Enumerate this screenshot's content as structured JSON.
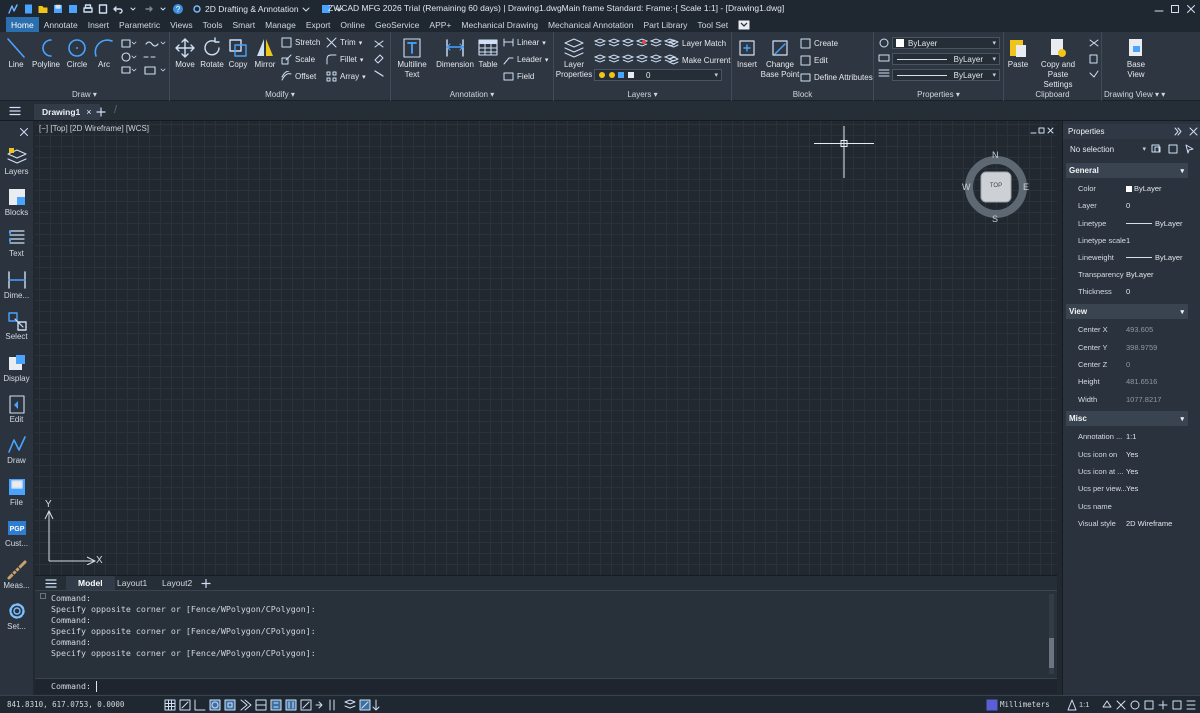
{
  "title_bar": {
    "workspace": "2D Drafting & Annotation",
    "title": "ZWCAD MFG 2026 Trial (Remaining 60 days) | Drawing1.dwgMain frame  Standard: Frame:-[ Scale 1:1] - [Drawing1.dwg]"
  },
  "ribbon_tabs": [
    "Home",
    "Annotate",
    "Insert",
    "Parametric",
    "Views",
    "Tools",
    "Smart",
    "Manage",
    "Export",
    "Online",
    "GeoService",
    "APP+",
    "Mechanical Drawing",
    "Mechanical Annotation",
    "Part Library",
    "Tool Set"
  ],
  "ribbon": {
    "draw": {
      "label": "Draw",
      "line": "Line",
      "polyline": "Polyline",
      "circle": "Circle",
      "arc": "Arc"
    },
    "modify": {
      "label": "Modify",
      "move": "Move",
      "rotate": "Rotate",
      "copy": "Copy",
      "mirror": "Mirror",
      "stretch": "Stretch",
      "scale": "Scale",
      "offset": "Offset",
      "trim": "Trim",
      "fillet": "Fillet",
      "array": "Array"
    },
    "annotation": {
      "label": "Annotation",
      "multiline_text_1": "Multiline",
      "multiline_text_2": "Text",
      "dimension": "Dimension",
      "table": "Table",
      "linear": "Linear",
      "leader": "Leader",
      "field": "Field"
    },
    "layers": {
      "label": "Layers",
      "layer_properties_1": "Layer",
      "layer_properties_2": "Properties",
      "layer_match": "Layer Match",
      "make_current": "Make Current",
      "current_layer": "0"
    },
    "block": {
      "label": "Block",
      "insert": "Insert",
      "change_base_1": "Change",
      "change_base_2": "Base Point",
      "create": "Create",
      "edit": "Edit",
      "define_attributes": "Define Attributes"
    },
    "properties": {
      "label": "Properties",
      "color": "ByLayer",
      "linetype": "ByLayer",
      "lineweight": "ByLayer"
    },
    "clipboard": {
      "label": "Clipboard",
      "paste": "Paste",
      "copy_paste_1": "Copy and Paste",
      "copy_paste_2": "Settings"
    },
    "drawing_view": {
      "label": "Drawing View",
      "base_view_1": "Base",
      "base_view_2": "View"
    }
  },
  "doc_tabs": {
    "active": "Drawing1"
  },
  "left_toolbar": [
    "Layers",
    "Blocks",
    "Text",
    "Dime...",
    "Select",
    "Display",
    "Edit",
    "Draw",
    "File",
    "Cust...",
    "Meas...",
    "Set..."
  ],
  "viewport": {
    "label": "[−] [Top] [2D Wireframe] [WCS]",
    "viewcube": {
      "n": "N",
      "s": "S",
      "e": "E",
      "w": "W",
      "top": "TOP"
    },
    "ucs": {
      "x": "X",
      "y": "Y"
    }
  },
  "layout_tabs": [
    "Model",
    "Layout1",
    "Layout2"
  ],
  "command_history": [
    "Command:",
    "Specify opposite corner or [Fence/WPolygon/CPolygon]:",
    "Command:",
    "Specify opposite corner or [Fence/WPolygon/CPolygon]:",
    "Command:",
    "Specify opposite corner or [Fence/WPolygon/CPolygon]:"
  ],
  "command_prompt": "Command:",
  "status_bar": {
    "coords": "841.8310, 617.0753, 0.0000",
    "units": "Millimeters",
    "scale": "1:1"
  },
  "properties_panel": {
    "title": "Properties",
    "selection": "No selection",
    "general": {
      "label": "General",
      "rows": [
        {
          "k": "Color",
          "v": "ByLayer"
        },
        {
          "k": "Layer",
          "v": "0"
        },
        {
          "k": "Linetype",
          "v": "ByLayer"
        },
        {
          "k": "Linetype scale",
          "v": "1"
        },
        {
          "k": "Lineweight",
          "v": "ByLayer"
        },
        {
          "k": "Transparency",
          "v": "ByLayer"
        },
        {
          "k": "Thickness",
          "v": "0"
        }
      ]
    },
    "view": {
      "label": "View",
      "rows": [
        {
          "k": "Center X",
          "v": "493.605"
        },
        {
          "k": "Center Y",
          "v": "398.9759"
        },
        {
          "k": "Center Z",
          "v": "0"
        },
        {
          "k": "Height",
          "v": "481.6516"
        },
        {
          "k": "Width",
          "v": "1077.8217"
        }
      ]
    },
    "misc": {
      "label": "Misc",
      "rows": [
        {
          "k": "Annotation ...",
          "v": "1:1"
        },
        {
          "k": "Ucs icon on",
          "v": "Yes"
        },
        {
          "k": "Ucs icon at ...",
          "v": "Yes"
        },
        {
          "k": "Ucs per view...",
          "v": "Yes"
        },
        {
          "k": "Ucs name",
          "v": ""
        },
        {
          "k": "Visual style",
          "v": "2D Wireframe"
        }
      ]
    }
  }
}
